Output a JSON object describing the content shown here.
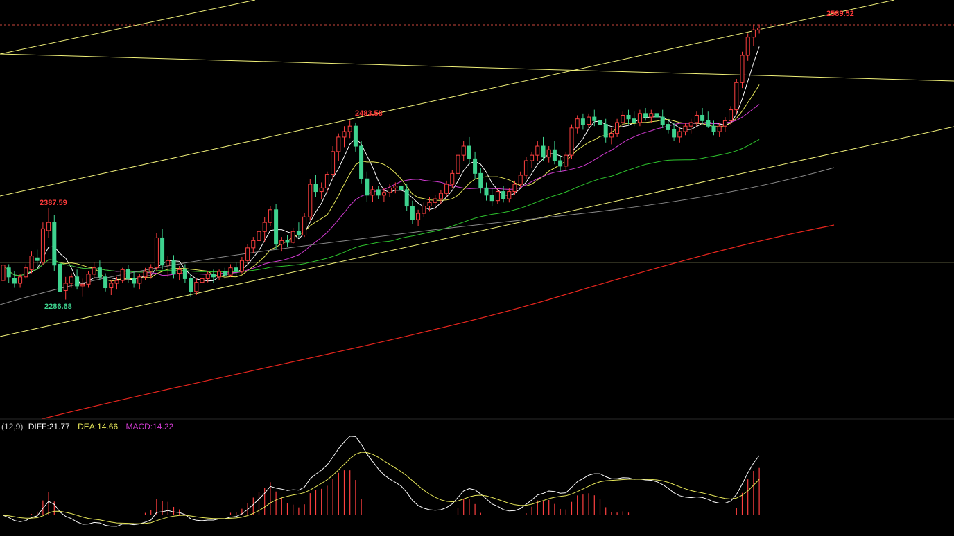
{
  "chart_data": [
    {
      "type": "candlestick",
      "title": "",
      "price_range": [
        2200,
        2600
      ],
      "last_price": 2589.52,
      "annotations": {
        "high_right": "2589.52",
        "high_mid": "2483.58",
        "high_left": "2387.59",
        "low_left": "2286.68"
      },
      "reference_levels": {
        "dashed_last": 2589.52,
        "horizontal_grey": 2308
      },
      "candles": [
        [
          2308,
          2330,
          2300,
          2325
        ],
        [
          2322,
          2326,
          2305,
          2312
        ],
        [
          2310,
          2318,
          2300,
          2305
        ],
        [
          2305,
          2315,
          2300,
          2312
        ],
        [
          2312,
          2326,
          2310,
          2322
        ],
        [
          2320,
          2340,
          2316,
          2335
        ],
        [
          2333,
          2342,
          2320,
          2330
        ],
        [
          2328,
          2372,
          2325,
          2365
        ],
        [
          2363,
          2388,
          2355,
          2372
        ],
        [
          2372,
          2380,
          2318,
          2325
        ],
        [
          2326,
          2332,
          2290,
          2296
        ],
        [
          2297,
          2312,
          2287,
          2305
        ],
        [
          2305,
          2316,
          2300,
          2312
        ],
        [
          2312,
          2320,
          2298,
          2302
        ],
        [
          2302,
          2310,
          2290,
          2304
        ],
        [
          2304,
          2318,
          2300,
          2315
        ],
        [
          2315,
          2328,
          2310,
          2322
        ],
        [
          2322,
          2330,
          2308,
          2312
        ],
        [
          2312,
          2316,
          2296,
          2300
        ],
        [
          2300,
          2308,
          2292,
          2305
        ],
        [
          2305,
          2312,
          2298,
          2308
        ],
        [
          2308,
          2322,
          2305,
          2320
        ],
        [
          2320,
          2325,
          2305,
          2310
        ],
        [
          2310,
          2318,
          2300,
          2305
        ],
        [
          2305,
          2315,
          2298,
          2312
        ],
        [
          2312,
          2322,
          2308,
          2318
        ],
        [
          2318,
          2326,
          2310,
          2322
        ],
        [
          2322,
          2360,
          2318,
          2355
        ],
        [
          2355,
          2365,
          2320,
          2325
        ],
        [
          2325,
          2335,
          2312,
          2330
        ],
        [
          2330,
          2336,
          2310,
          2316
        ],
        [
          2316,
          2324,
          2308,
          2320
        ],
        [
          2320,
          2326,
          2305,
          2310
        ],
        [
          2310,
          2315,
          2290,
          2296
        ],
        [
          2296,
          2310,
          2292,
          2306
        ],
        [
          2306,
          2314,
          2300,
          2310
        ],
        [
          2310,
          2318,
          2306,
          2315
        ],
        [
          2315,
          2320,
          2305,
          2312
        ],
        [
          2312,
          2320,
          2308,
          2318
        ],
        [
          2318,
          2322,
          2310,
          2314
        ],
        [
          2314,
          2326,
          2312,
          2322
        ],
        [
          2322,
          2328,
          2314,
          2318
        ],
        [
          2318,
          2334,
          2316,
          2330
        ],
        [
          2330,
          2348,
          2326,
          2344
        ],
        [
          2344,
          2356,
          2338,
          2352
        ],
        [
          2352,
          2366,
          2348,
          2362
        ],
        [
          2362,
          2378,
          2350,
          2372
        ],
        [
          2372,
          2390,
          2368,
          2386
        ],
        [
          2386,
          2392,
          2342,
          2348
        ],
        [
          2348,
          2356,
          2340,
          2352
        ],
        [
          2352,
          2358,
          2345,
          2350
        ],
        [
          2350,
          2366,
          2348,
          2362
        ],
        [
          2362,
          2372,
          2355,
          2358
        ],
        [
          2358,
          2382,
          2356,
          2378
        ],
        [
          2378,
          2420,
          2374,
          2414
        ],
        [
          2414,
          2424,
          2400,
          2406
        ],
        [
          2406,
          2416,
          2398,
          2410
        ],
        [
          2410,
          2428,
          2405,
          2425
        ],
        [
          2425,
          2456,
          2420,
          2450
        ],
        [
          2450,
          2470,
          2440,
          2466
        ],
        [
          2466,
          2478,
          2455,
          2472
        ],
        [
          2472,
          2484,
          2465,
          2478
        ],
        [
          2478,
          2482,
          2450,
          2456
        ],
        [
          2456,
          2462,
          2415,
          2420
        ],
        [
          2420,
          2428,
          2395,
          2402
        ],
        [
          2402,
          2412,
          2395,
          2408
        ],
        [
          2408,
          2412,
          2398,
          2402
        ],
        [
          2402,
          2410,
          2395,
          2405
        ],
        [
          2405,
          2414,
          2400,
          2410
        ],
        [
          2410,
          2416,
          2404,
          2412
        ],
        [
          2412,
          2418,
          2406,
          2408
        ],
        [
          2408,
          2414,
          2385,
          2390
        ],
        [
          2390,
          2396,
          2370,
          2375
        ],
        [
          2375,
          2386,
          2368,
          2382
        ],
        [
          2382,
          2394,
          2378,
          2390
        ],
        [
          2390,
          2400,
          2384,
          2394
        ],
        [
          2394,
          2402,
          2386,
          2398
        ],
        [
          2398,
          2408,
          2392,
          2404
        ],
        [
          2404,
          2418,
          2400,
          2414
        ],
        [
          2414,
          2430,
          2410,
          2426
        ],
        [
          2426,
          2450,
          2422,
          2446
        ],
        [
          2446,
          2462,
          2440,
          2456
        ],
        [
          2456,
          2466,
          2436,
          2442
        ],
        [
          2442,
          2450,
          2420,
          2426
        ],
        [
          2426,
          2432,
          2404,
          2410
        ],
        [
          2410,
          2416,
          2396,
          2402
        ],
        [
          2402,
          2410,
          2390,
          2396
        ],
        [
          2396,
          2410,
          2392,
          2406
        ],
        [
          2406,
          2412,
          2394,
          2398
        ],
        [
          2398,
          2410,
          2394,
          2406
        ],
        [
          2406,
          2418,
          2402,
          2414
        ],
        [
          2414,
          2428,
          2410,
          2424
        ],
        [
          2424,
          2444,
          2420,
          2440
        ],
        [
          2440,
          2450,
          2432,
          2446
        ],
        [
          2446,
          2462,
          2440,
          2456
        ],
        [
          2456,
          2466,
          2440,
          2444
        ],
        [
          2444,
          2456,
          2438,
          2452
        ],
        [
          2452,
          2462,
          2436,
          2440
        ],
        [
          2440,
          2446,
          2428,
          2434
        ],
        [
          2434,
          2450,
          2430,
          2446
        ],
        [
          2446,
          2480,
          2442,
          2476
        ],
        [
          2476,
          2490,
          2470,
          2486
        ],
        [
          2486,
          2492,
          2474,
          2480
        ],
        [
          2480,
          2492,
          2476,
          2488
        ],
        [
          2488,
          2496,
          2478,
          2484
        ],
        [
          2484,
          2494,
          2476,
          2480
        ],
        [
          2480,
          2486,
          2460,
          2466
        ],
        [
          2466,
          2476,
          2458,
          2470
        ],
        [
          2470,
          2486,
          2466,
          2482
        ],
        [
          2482,
          2494,
          2478,
          2490
        ],
        [
          2490,
          2496,
          2480,
          2486
        ],
        [
          2486,
          2494,
          2478,
          2482
        ],
        [
          2482,
          2496,
          2478,
          2492
        ],
        [
          2492,
          2498,
          2484,
          2488
        ],
        [
          2488,
          2496,
          2482,
          2492
        ],
        [
          2492,
          2498,
          2484,
          2488
        ],
        [
          2488,
          2496,
          2476,
          2480
        ],
        [
          2480,
          2486,
          2470,
          2474
        ],
        [
          2474,
          2482,
          2462,
          2466
        ],
        [
          2466,
          2476,
          2460,
          2472
        ],
        [
          2472,
          2482,
          2468,
          2478
        ],
        [
          2478,
          2486,
          2470,
          2482
        ],
        [
          2482,
          2494,
          2478,
          2490
        ],
        [
          2490,
          2498,
          2480,
          2484
        ],
        [
          2484,
          2494,
          2476,
          2478
        ],
        [
          2478,
          2484,
          2468,
          2472
        ],
        [
          2472,
          2482,
          2466,
          2478
        ],
        [
          2478,
          2488,
          2472,
          2484
        ],
        [
          2484,
          2500,
          2480,
          2496
        ],
        [
          2496,
          2530,
          2492,
          2526
        ],
        [
          2526,
          2560,
          2520,
          2556
        ],
        [
          2556,
          2580,
          2550,
          2576
        ],
        [
          2576,
          2590,
          2566,
          2584
        ],
        [
          2584,
          2590,
          2580,
          2586
        ]
      ],
      "overlays": [
        {
          "name": "MA5",
          "color": "#ffffff"
        },
        {
          "name": "MA10",
          "color": "#e8e85a"
        },
        {
          "name": "MA20",
          "color": "#d23bd2"
        },
        {
          "name": "MA60",
          "color": "#2ec52e"
        },
        {
          "name": "MA120",
          "color": "#8a8a8a"
        },
        {
          "name": "MA250",
          "color": "#e8261e"
        }
      ],
      "colors": {
        "up": "#ff4040",
        "down": "#3ed38f",
        "trend": "#f2f27a",
        "label_red": "#ff3b3b",
        "label_green": "#3ed38f"
      }
    },
    {
      "type": "line+bar",
      "indicator": "MACD",
      "header": {
        "params": "(12,9)",
        "diff_text": "DIFF:21.77",
        "dea_text": "DEA:14.66",
        "macd_text": "MACD:14.22"
      },
      "last_values": {
        "DIFF": 21.77,
        "DEA": 14.66,
        "MACD": 14.22
      },
      "colors": {
        "diff": "#ffffff",
        "dea": "#e8e85a",
        "macd": "#d23bd2",
        "bar": "#ff4040"
      }
    }
  ]
}
